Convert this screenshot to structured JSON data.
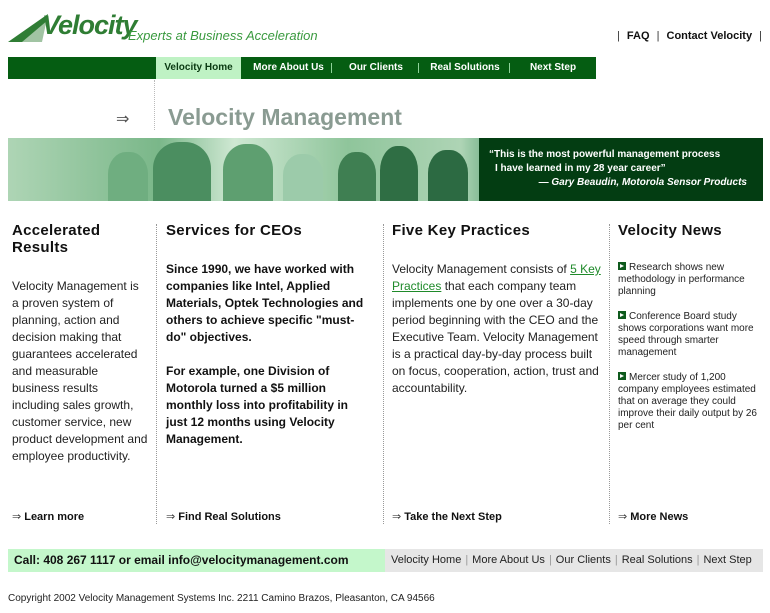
{
  "brand": {
    "name": "Velocity",
    "tagline": "Experts at Business Acceleration"
  },
  "top_links": [
    "FAQ",
    "Contact Velocity"
  ],
  "nav": [
    "Velocity Home",
    "More About Us",
    "Our Clients",
    "Real Solutions",
    "Next Step"
  ],
  "page_title": "Velocity Management",
  "quote": {
    "line1": "“This is the most powerful management process",
    "line2": "I have learned in my 28 year career”",
    "author": "— Gary Beaudin, Motorola Sensor Products"
  },
  "col1": {
    "heading": "Accelerated Results",
    "body": "Velocity Management is a proven system of planning, action and decision making that guarantees accelerated and measurable business results including sales growth, customer service, new product development and employee productivity.",
    "more": "Learn more"
  },
  "col2": {
    "heading": "Services for CEOs",
    "para1": "Since 1990, we have worked with companies like Intel, Applied Materials, Optek Technologies and others to achieve specific \"must-do\" objectives.",
    "para2": "For example, one Division of Motorola turned a $5 million monthly loss into profitability in just 12 months using Velocity Management.",
    "more": "Find Real Solutions"
  },
  "col3": {
    "heading": "Five Key Practices",
    "body_before": "Velocity Management consists of ",
    "link": "5 Key Practices",
    "body_after": " that each company team implements one by one over a 30-day period beginning with the CEO and the Executive Team. Velocity Management is a practical day-by-day process built on focus, cooperation, action, trust and accountability.",
    "more": "Take the Next Step"
  },
  "col4": {
    "heading": "Velocity News",
    "items": [
      "Research shows new methodology in performance planning",
      "Conference Board study shows corporations want more speed through smarter management",
      "Mercer study of 1,200 company employees estimated that on average they could improve their daily output by 26 per cent"
    ],
    "more": "More News"
  },
  "footer": {
    "contact": "Call: 408 267 1117 or email info@velocitymanagement.com",
    "links": [
      "Velocity Home",
      "More About Us",
      "Our Clients",
      "Real Solutions",
      "Next Step"
    ],
    "copyright": "Copyright 2002 Velocity Management Systems Inc. 2211 Camino Brazos, Pleasanton, CA 94566"
  },
  "colors": {
    "brand_green": "#055d12",
    "accent_light": "#c4f7cb",
    "title_gray": "#8a9b92"
  }
}
